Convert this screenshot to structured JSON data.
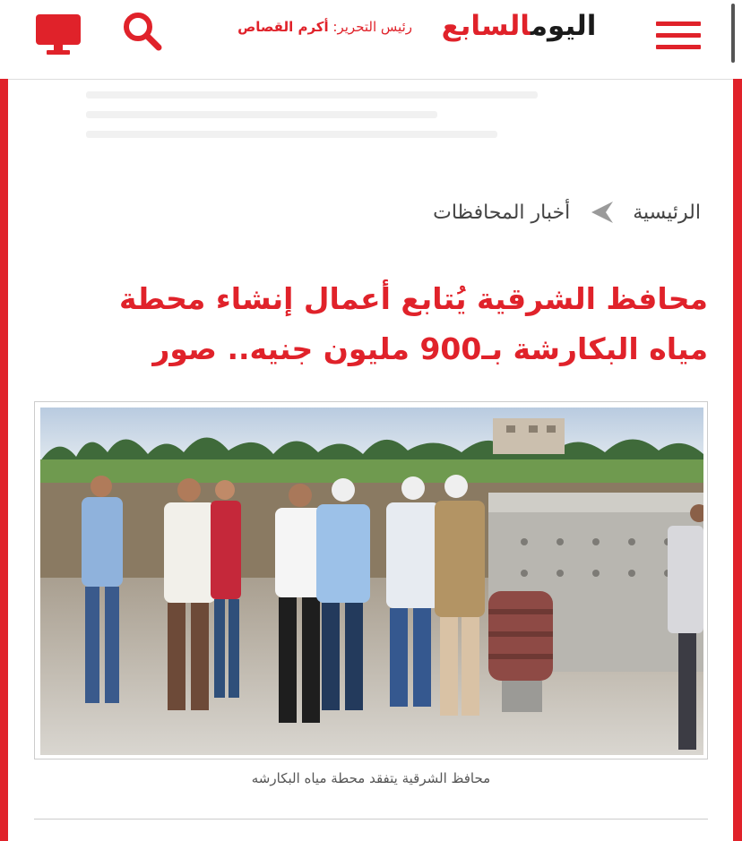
{
  "header": {
    "logo_part1": "اليوم",
    "logo_part2": "السابع",
    "editor_label": "رئيس التحرير:",
    "editor_name": "أكرم القصاص",
    "icons": {
      "monitor": "monitor-icon",
      "search": "search-icon",
      "menu": "hamburger-menu-icon"
    }
  },
  "breadcrumb": {
    "home": "الرئيسية",
    "section": "أخبار المحافظات"
  },
  "article": {
    "title": "محافظ الشرقية يُتابع أعمال إنشاء محطة مياه البكارشة بـ900 مليون جنيه.. صور",
    "caption": "محافظ الشرقية يتفقد محطة مياه البكارشه"
  },
  "colors": {
    "brand_red": "#e0222a",
    "text_dark": "#333333"
  }
}
